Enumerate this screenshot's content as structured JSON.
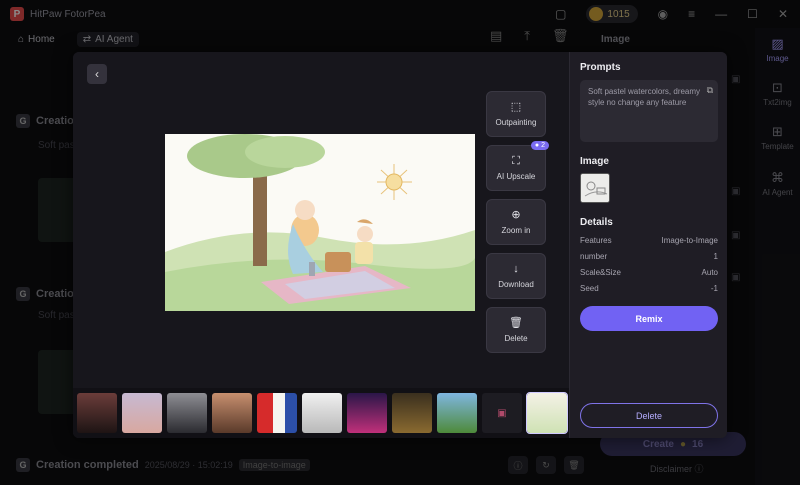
{
  "app": {
    "title": "HitPaw FotorPea",
    "credits": "1015"
  },
  "nav": {
    "home": "Home",
    "agent": "AI Agent"
  },
  "background": {
    "row_title": "Creation completed",
    "row_title_short": "Creatio",
    "row_sub": "Soft pas",
    "row_tag": "Image-to-image",
    "row_date": "2025/08/29 · 15:02:19",
    "right_label": "Image",
    "create_label": "Create",
    "create_cost": "16",
    "disclaimer": "Disclaimer"
  },
  "rail": {
    "items": [
      "Image",
      "Txt2img",
      "Template",
      "AI Agent"
    ]
  },
  "modal": {
    "tools": [
      {
        "label": "Outpainting",
        "icon": "outpainting-icon"
      },
      {
        "label": "AI Upscale",
        "icon": "upscale-icon",
        "badge": "2"
      },
      {
        "label": "Zoom in",
        "icon": "zoom-in-icon"
      },
      {
        "label": "Download",
        "icon": "download-icon"
      },
      {
        "label": "Delete",
        "icon": "trash-icon"
      }
    ]
  },
  "panel": {
    "prompts_heading": "Prompts",
    "prompt_text": "Soft pastel watercolors, dreamy style no change any feature",
    "image_heading": "Image",
    "details_heading": "Details",
    "details": [
      {
        "key": "Features",
        "value": "Image-to-Image"
      },
      {
        "key": "number",
        "value": "1"
      },
      {
        "key": "Scale&Size",
        "value": "Auto"
      },
      {
        "key": "Seed",
        "value": "-1"
      }
    ],
    "remix_label": "Remix",
    "delete_label": "Delete"
  },
  "colors": {
    "accent": "#7162f3",
    "modal_bg": "#1c1a22",
    "app_bg": "#0d0d10"
  }
}
